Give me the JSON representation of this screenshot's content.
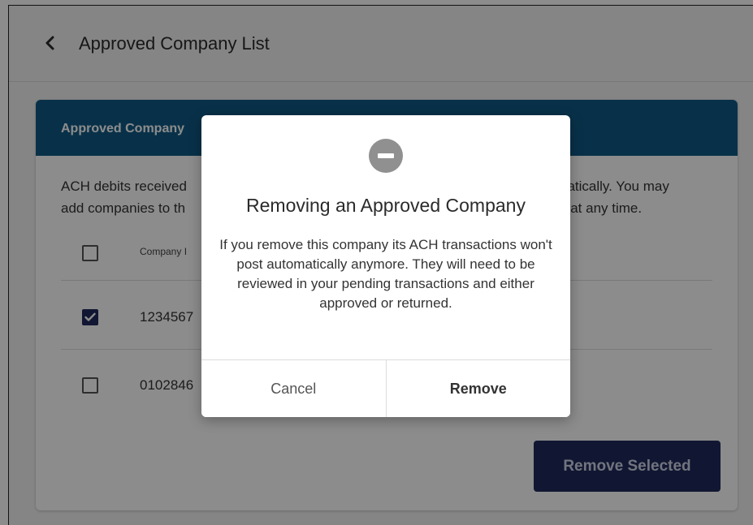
{
  "header": {
    "title": "Approved Company List"
  },
  "card": {
    "heading": "Approved Company",
    "description_left": "ACH debits receiveda<br>",
    "description_line1_left": "ACH debits received",
    "description_line2_left": "add companies to th",
    "description_line1_right": "natically. You may",
    "description_line2_right": "s at any time.",
    "column_header": "Company I",
    "rows": [
      {
        "id": "1234567",
        "checked": true
      },
      {
        "id": "0102846",
        "checked": false
      }
    ],
    "remove_selected_label": "Remove Selected"
  },
  "modal": {
    "title": "Removing an Approved Company",
    "body": "If you remove this company its ACH transactions won't post automatically anymore. They will need to be reviewed in your pending transactions and either approved or returned.",
    "cancel_label": "Cancel",
    "remove_label": "Remove"
  },
  "colors": {
    "card_header": "#0f5a86",
    "primary_button": "#1f2a5c",
    "modal_icon": "#909090"
  },
  "icons": {
    "back": "chevron-left-icon",
    "modal": "minus-circle-icon",
    "checkbox_checked": "checkmark-icon"
  }
}
